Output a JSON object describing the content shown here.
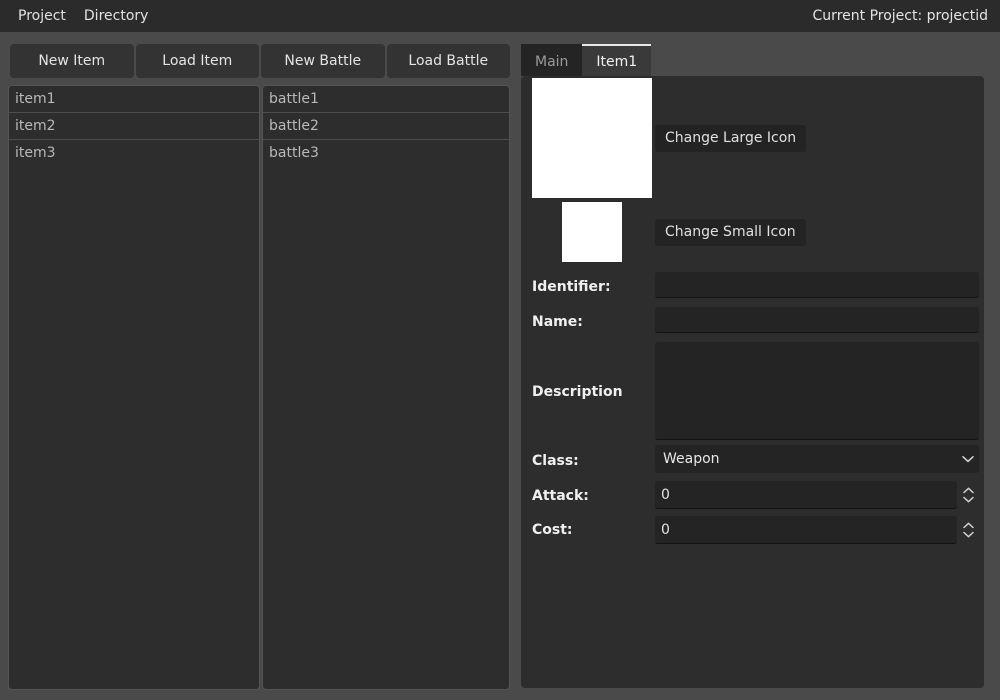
{
  "menubar": {
    "items": [
      {
        "label": "Project"
      },
      {
        "label": "Directory"
      }
    ],
    "current_project": "Current Project: projectid"
  },
  "toolbar": {
    "buttons": [
      {
        "label": "New Item"
      },
      {
        "label": "Load Item"
      },
      {
        "label": "New Battle"
      },
      {
        "label": "Load Battle"
      }
    ]
  },
  "item_list": {
    "rows": [
      {
        "label": "item1"
      },
      {
        "label": "item2"
      },
      {
        "label": "item3"
      }
    ]
  },
  "battle_list": {
    "rows": [
      {
        "label": "battle1"
      },
      {
        "label": "battle2"
      },
      {
        "label": "battle3"
      }
    ]
  },
  "tabs": [
    {
      "label": "Main",
      "active": false
    },
    {
      "label": "Item1",
      "active": true
    }
  ],
  "item_editor": {
    "large_icon_button": "Change Large Icon",
    "small_icon_button": "Change Small Icon",
    "large_icon_color": "#ffffff",
    "small_icon_color": "#ffffff",
    "fields": {
      "identifier": {
        "label": "Identifier:",
        "value": "",
        "placeholder": ""
      },
      "name": {
        "label": "Name:",
        "value": "",
        "placeholder": ""
      },
      "description": {
        "label": "Description",
        "value": "",
        "placeholder": ""
      },
      "class": {
        "label": "Class:",
        "value": "Weapon"
      },
      "attack": {
        "label": "Attack:",
        "value": "0"
      },
      "cost": {
        "label": "Cost:",
        "value": "0"
      }
    }
  },
  "colors": {
    "window_bg": "#4a4a4a",
    "panel_bg": "#2d2d2d",
    "menubar_bg": "#2b2b2b",
    "field_bg": "#242424",
    "active_tab_bg": "#3a3a3a",
    "accent": "#e8e8e8"
  }
}
